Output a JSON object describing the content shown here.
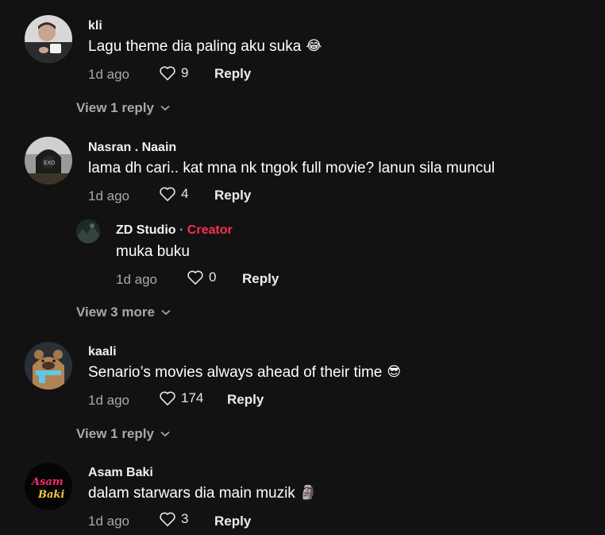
{
  "comments": [
    {
      "username": "kli",
      "text": "Lagu theme dia paling aku suka",
      "emoji": "😂",
      "time": "1d ago",
      "likes": "9",
      "reply_label": "Reply",
      "view_replies": "View 1 reply"
    },
    {
      "username": "Nasran . Naain",
      "text": "lama dh cari.. kat mna nk tngok full movie? lanun sila muncul",
      "time": "1d ago",
      "likes": "4",
      "reply_label": "Reply",
      "view_replies": "View 3 more",
      "reply": {
        "username": "ZD Studio",
        "separator": "·",
        "badge": "Creator",
        "text": "muka buku",
        "time": "1d ago",
        "likes": "0",
        "reply_label": "Reply"
      }
    },
    {
      "username": "kaali",
      "text": "Senario’s movies always ahead of their time",
      "emoji": "😎",
      "time": "1d ago",
      "likes": "174",
      "reply_label": "Reply",
      "view_replies": "View 1 reply"
    },
    {
      "username": "Asam Baki",
      "text": "dalam starwars dia main muzik",
      "emoji": "🗿",
      "time": "1d ago",
      "likes": "3",
      "reply_label": "Reply",
      "avatar_logo": "Asam Baki"
    }
  ],
  "colors": {
    "background": "#121212",
    "creator_badge": "#fe2c55",
    "muted_text": "#a8a8a8"
  },
  "icons": {
    "like": "heart-outline-icon",
    "expand": "chevron-down-icon"
  }
}
